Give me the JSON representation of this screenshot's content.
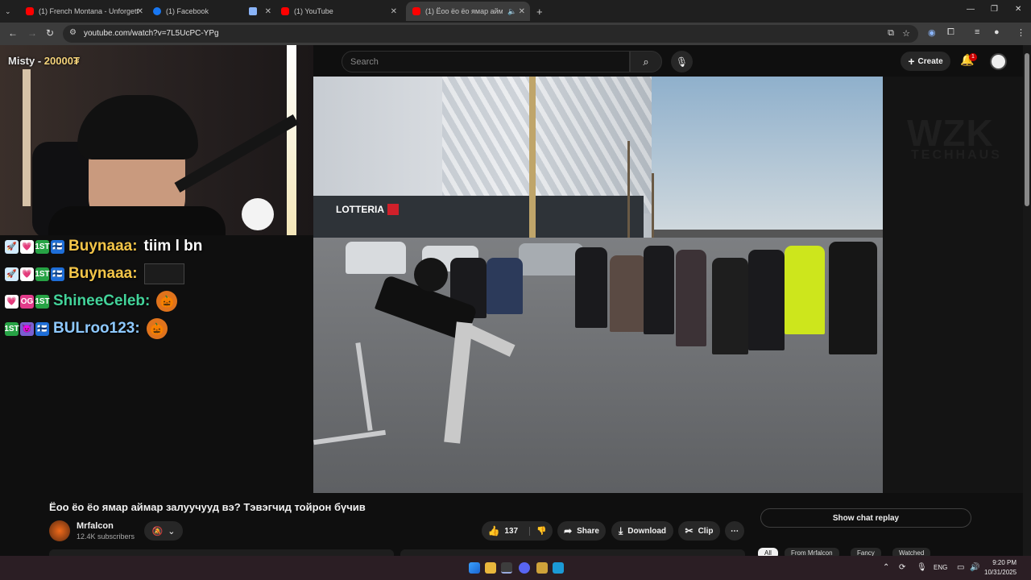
{
  "browser": {
    "tabs": [
      {
        "title": "(1) French Montana - Unforgett"
      },
      {
        "title": "(1) Facebook"
      },
      {
        "title": ""
      },
      {
        "title": "(1) YouTube"
      },
      {
        "title": "(1) Ёоо ёо ёо ямар аймар"
      }
    ],
    "url": "youtube.com/watch?v=7L5UcPC-YPg"
  },
  "youtube": {
    "search_placeholder": "Search",
    "create_label": "Create",
    "notification_count": "1",
    "video": {
      "title": "Ёоо ёо ёо ямар аймар залуучууд вэ? Тэвэгчид тойрон бүчив",
      "channel": "Mrfalcon",
      "subscribers": "12.4K subscribers",
      "likes": "137",
      "share_label": "Share",
      "download_label": "Download",
      "clip_label": "Clip"
    },
    "chat_replay_label": "Show chat replay",
    "filters": [
      "All",
      "From Mrfalcon",
      "Fancy",
      "Watched"
    ],
    "watermark": "WZK",
    "watermark_sub": "TECHHAUS"
  },
  "video_scene": {
    "sign": "LOTTERIA"
  },
  "stream_overlay": {
    "streamer": "Misty - ",
    "streamer_count": "20000₮",
    "chat": [
      {
        "badges": [
          "🚀",
          "💗",
          "1ST",
          "🇫🇮"
        ],
        "name": "Buynaaa:",
        "name_color": "#f3c548",
        "message": "tiim l bn"
      },
      {
        "badges": [
          "🚀",
          "💗",
          "1ST",
          "🇫🇮"
        ],
        "name": "Buynaaa:",
        "name_color": "#f3c548",
        "message": ""
      },
      {
        "badges": [
          "💗",
          "OG",
          "1ST"
        ],
        "name": "ShineeCeleb:",
        "name_color": "#43d39a",
        "message": ""
      },
      {
        "badges": [
          "1ST",
          "😈",
          "🇫🇮"
        ],
        "name": "BULroo123:",
        "name_color": "#8ec9ff",
        "message": ""
      }
    ]
  },
  "taskbar": {
    "language": "ENG",
    "time": "9:20 PM",
    "date": "10/31/2025"
  }
}
